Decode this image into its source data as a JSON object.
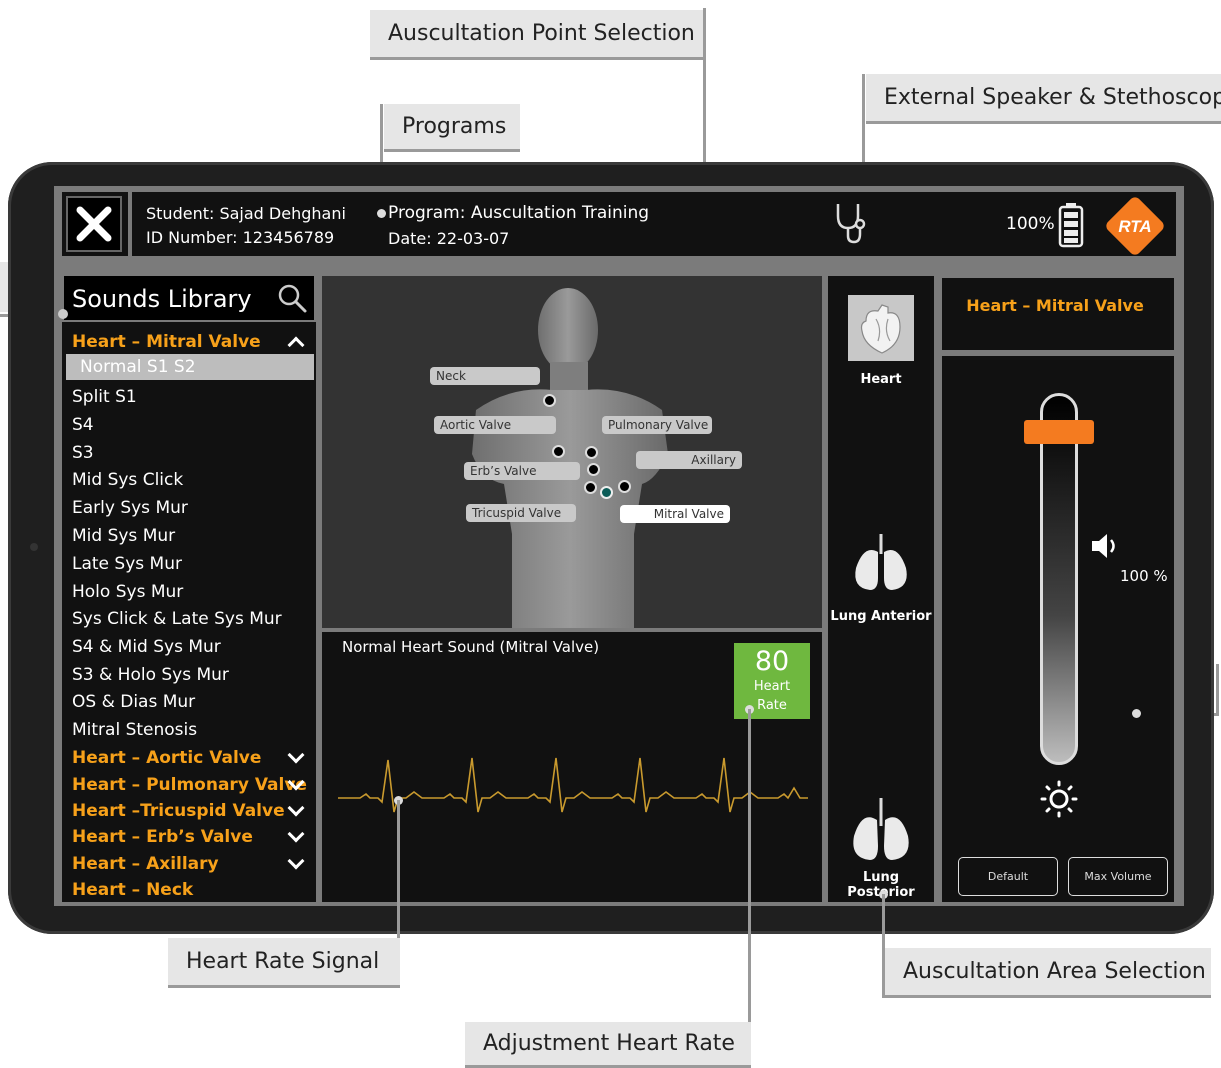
{
  "callouts": {
    "auscultation_point": "Auscultation Point Selection",
    "programs": "Programs",
    "external_speaker": "External Speaker & Stethoscope",
    "heart_rate_signal": "Heart Rate Signal",
    "adjustment_heart_rate": "Adjustment Heart Rate",
    "auscultation_area": "Auscultation Area Selection"
  },
  "header": {
    "student": "Student: Sajad Dehghani",
    "id_number": "ID Number: 123456789",
    "program": "Program: Auscultation Training",
    "date": "Date: 22-03-07",
    "battery": "100%",
    "logo_text": "RTA"
  },
  "library": {
    "title": "Sounds Library",
    "open_group": "Heart – Mitral Valve",
    "selected_item": "Normal S1 S2",
    "items": [
      "Split S1",
      "S4",
      "S3",
      "Mid Sys Click",
      "Early Sys Mur",
      "Mid Sys Mur",
      "Late Sys Mur",
      "Holo Sys Mur",
      "Sys Click & Late Sys Mur",
      "S4 & Mid Sys Mur",
      "S3 & Holo Sys Mur",
      "OS & Dias Mur",
      "Mitral Stenosis"
    ],
    "groups": [
      "Heart – Aortic Valve",
      "Heart – Pulmonary Valve",
      "Heart –Tricuspid Valve",
      "Heart – Erb’s Valve",
      "Heart – Axillary",
      "Heart – Neck"
    ]
  },
  "body_points": {
    "neck": "Neck",
    "aortic": "Aortic Valve",
    "pulmonary": "Pulmonary Valve",
    "axillary": "Axillary",
    "erbs": "Erb’s Valve",
    "tricuspid": "Tricuspid Valve",
    "mitral": "Mitral Valve"
  },
  "signal": {
    "title": "Normal Heart Sound (Mitral Valve)",
    "heart_rate_value": "80",
    "heart_rate_label": "Heart Rate"
  },
  "areas": {
    "heart": "Heart",
    "lung_anterior": "Lung Anterior",
    "lung_posterior": "Lung Posterior"
  },
  "volume": {
    "current_selection": "Heart – Mitral Valve",
    "percent": "100 %",
    "level": 1.0,
    "default_label": "Default",
    "max_label": "Max Volume"
  },
  "colors": {
    "accent": "#f7a11a",
    "heart_rate_bg": "#6fb83f",
    "slider_handle": "#f47b20",
    "logo": "#f47b20"
  },
  "icons": [
    "close-icon",
    "search-icon",
    "chevron-up-icon",
    "chevron-down-icon",
    "stethoscope-icon",
    "battery-icon",
    "heart-icon",
    "lung-icon",
    "speaker-icon",
    "brightness-icon"
  ]
}
